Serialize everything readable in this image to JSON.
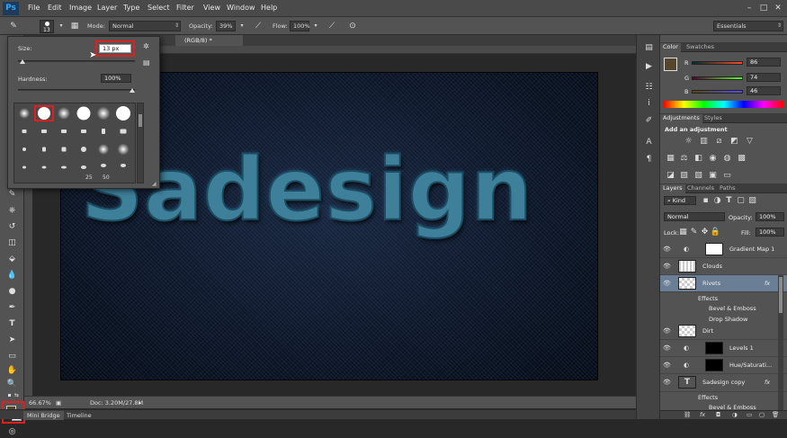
{
  "app": {
    "logo": "Ps"
  },
  "menu": [
    "File",
    "Edit",
    "Image",
    "Layer",
    "Type",
    "Select",
    "Filter",
    "View",
    "Window",
    "Help"
  ],
  "options_bar": {
    "brush_size": "13",
    "mode_label": "Mode:",
    "mode_value": "Normal",
    "opacity_label": "Opacity:",
    "opacity_value": "39%",
    "flow_label": "Flow:",
    "flow_value": "100%",
    "workspace": "Essentials"
  },
  "document": {
    "tab_title": "(RGB/8) *"
  },
  "canvas": {
    "artwork_text": "Sadesign"
  },
  "brush_popup": {
    "size_label": "Size:",
    "size_value": "13 px",
    "hardness_label": "Hardness:",
    "hardness_value": "100%",
    "brush_numbers": [
      "25",
      "50"
    ]
  },
  "status_bar": {
    "zoom": "66.67%",
    "doc_size": "Doc: 3.20M/27.8M"
  },
  "bottom_tabs": [
    "Mini Bridge",
    "Timeline"
  ],
  "color_panel": {
    "tabs": [
      "Color",
      "Swatches"
    ],
    "fg_color": "#56462e",
    "rows": [
      {
        "label": "R",
        "value": "86"
      },
      {
        "label": "G",
        "value": "74"
      },
      {
        "label": "B",
        "value": "46"
      }
    ]
  },
  "adjustments_panel": {
    "tabs": [
      "Adjustments",
      "Styles"
    ],
    "title": "Add an adjustment"
  },
  "layers_panel": {
    "tabs": [
      "Layers",
      "Channels",
      "Paths"
    ],
    "filter_label": "Kind",
    "blend_mode": "Normal",
    "opacity_label": "Opacity:",
    "opacity_value": "100%",
    "lock_label": "Lock:",
    "fill_label": "Fill:",
    "fill_value": "100%",
    "layers": [
      {
        "name": "Gradient Map 1"
      },
      {
        "name": "Clouds"
      },
      {
        "name": "Rivets",
        "fx": "fx"
      },
      {
        "name": "Effects"
      },
      {
        "name": "Bevel & Emboss"
      },
      {
        "name": "Drop Shadow"
      },
      {
        "name": "Dirt"
      },
      {
        "name": "Levels 1"
      },
      {
        "name": "Hue/Saturati..."
      },
      {
        "name": "Sadesign copy",
        "fx": "fx"
      },
      {
        "name": "Effects"
      },
      {
        "name": "Bevel & Emboss"
      }
    ]
  }
}
